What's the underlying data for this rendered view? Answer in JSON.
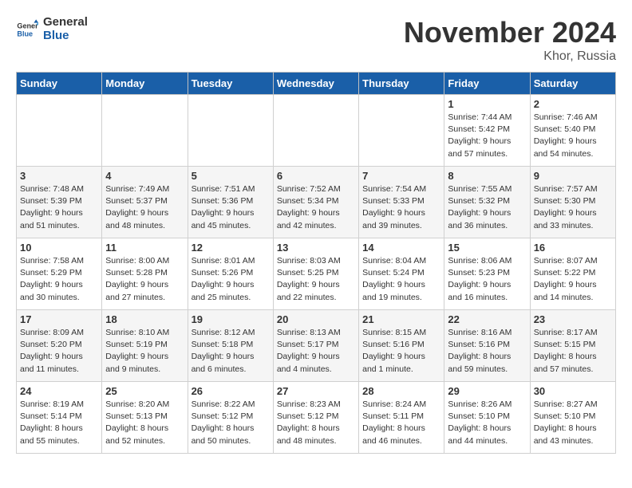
{
  "header": {
    "logo_line1": "General",
    "logo_line2": "Blue",
    "month": "November 2024",
    "location": "Khor, Russia"
  },
  "weekdays": [
    "Sunday",
    "Monday",
    "Tuesday",
    "Wednesday",
    "Thursday",
    "Friday",
    "Saturday"
  ],
  "weeks": [
    [
      {
        "day": "",
        "info": ""
      },
      {
        "day": "",
        "info": ""
      },
      {
        "day": "",
        "info": ""
      },
      {
        "day": "",
        "info": ""
      },
      {
        "day": "",
        "info": ""
      },
      {
        "day": "1",
        "info": "Sunrise: 7:44 AM\nSunset: 5:42 PM\nDaylight: 9 hours and 57 minutes."
      },
      {
        "day": "2",
        "info": "Sunrise: 7:46 AM\nSunset: 5:40 PM\nDaylight: 9 hours and 54 minutes."
      }
    ],
    [
      {
        "day": "3",
        "info": "Sunrise: 7:48 AM\nSunset: 5:39 PM\nDaylight: 9 hours and 51 minutes."
      },
      {
        "day": "4",
        "info": "Sunrise: 7:49 AM\nSunset: 5:37 PM\nDaylight: 9 hours and 48 minutes."
      },
      {
        "day": "5",
        "info": "Sunrise: 7:51 AM\nSunset: 5:36 PM\nDaylight: 9 hours and 45 minutes."
      },
      {
        "day": "6",
        "info": "Sunrise: 7:52 AM\nSunset: 5:34 PM\nDaylight: 9 hours and 42 minutes."
      },
      {
        "day": "7",
        "info": "Sunrise: 7:54 AM\nSunset: 5:33 PM\nDaylight: 9 hours and 39 minutes."
      },
      {
        "day": "8",
        "info": "Sunrise: 7:55 AM\nSunset: 5:32 PM\nDaylight: 9 hours and 36 minutes."
      },
      {
        "day": "9",
        "info": "Sunrise: 7:57 AM\nSunset: 5:30 PM\nDaylight: 9 hours and 33 minutes."
      }
    ],
    [
      {
        "day": "10",
        "info": "Sunrise: 7:58 AM\nSunset: 5:29 PM\nDaylight: 9 hours and 30 minutes."
      },
      {
        "day": "11",
        "info": "Sunrise: 8:00 AM\nSunset: 5:28 PM\nDaylight: 9 hours and 27 minutes."
      },
      {
        "day": "12",
        "info": "Sunrise: 8:01 AM\nSunset: 5:26 PM\nDaylight: 9 hours and 25 minutes."
      },
      {
        "day": "13",
        "info": "Sunrise: 8:03 AM\nSunset: 5:25 PM\nDaylight: 9 hours and 22 minutes."
      },
      {
        "day": "14",
        "info": "Sunrise: 8:04 AM\nSunset: 5:24 PM\nDaylight: 9 hours and 19 minutes."
      },
      {
        "day": "15",
        "info": "Sunrise: 8:06 AM\nSunset: 5:23 PM\nDaylight: 9 hours and 16 minutes."
      },
      {
        "day": "16",
        "info": "Sunrise: 8:07 AM\nSunset: 5:22 PM\nDaylight: 9 hours and 14 minutes."
      }
    ],
    [
      {
        "day": "17",
        "info": "Sunrise: 8:09 AM\nSunset: 5:20 PM\nDaylight: 9 hours and 11 minutes."
      },
      {
        "day": "18",
        "info": "Sunrise: 8:10 AM\nSunset: 5:19 PM\nDaylight: 9 hours and 9 minutes."
      },
      {
        "day": "19",
        "info": "Sunrise: 8:12 AM\nSunset: 5:18 PM\nDaylight: 9 hours and 6 minutes."
      },
      {
        "day": "20",
        "info": "Sunrise: 8:13 AM\nSunset: 5:17 PM\nDaylight: 9 hours and 4 minutes."
      },
      {
        "day": "21",
        "info": "Sunrise: 8:15 AM\nSunset: 5:16 PM\nDaylight: 9 hours and 1 minute."
      },
      {
        "day": "22",
        "info": "Sunrise: 8:16 AM\nSunset: 5:16 PM\nDaylight: 8 hours and 59 minutes."
      },
      {
        "day": "23",
        "info": "Sunrise: 8:17 AM\nSunset: 5:15 PM\nDaylight: 8 hours and 57 minutes."
      }
    ],
    [
      {
        "day": "24",
        "info": "Sunrise: 8:19 AM\nSunset: 5:14 PM\nDaylight: 8 hours and 55 minutes."
      },
      {
        "day": "25",
        "info": "Sunrise: 8:20 AM\nSunset: 5:13 PM\nDaylight: 8 hours and 52 minutes."
      },
      {
        "day": "26",
        "info": "Sunrise: 8:22 AM\nSunset: 5:12 PM\nDaylight: 8 hours and 50 minutes."
      },
      {
        "day": "27",
        "info": "Sunrise: 8:23 AM\nSunset: 5:12 PM\nDaylight: 8 hours and 48 minutes."
      },
      {
        "day": "28",
        "info": "Sunrise: 8:24 AM\nSunset: 5:11 PM\nDaylight: 8 hours and 46 minutes."
      },
      {
        "day": "29",
        "info": "Sunrise: 8:26 AM\nSunset: 5:10 PM\nDaylight: 8 hours and 44 minutes."
      },
      {
        "day": "30",
        "info": "Sunrise: 8:27 AM\nSunset: 5:10 PM\nDaylight: 8 hours and 43 minutes."
      }
    ]
  ]
}
